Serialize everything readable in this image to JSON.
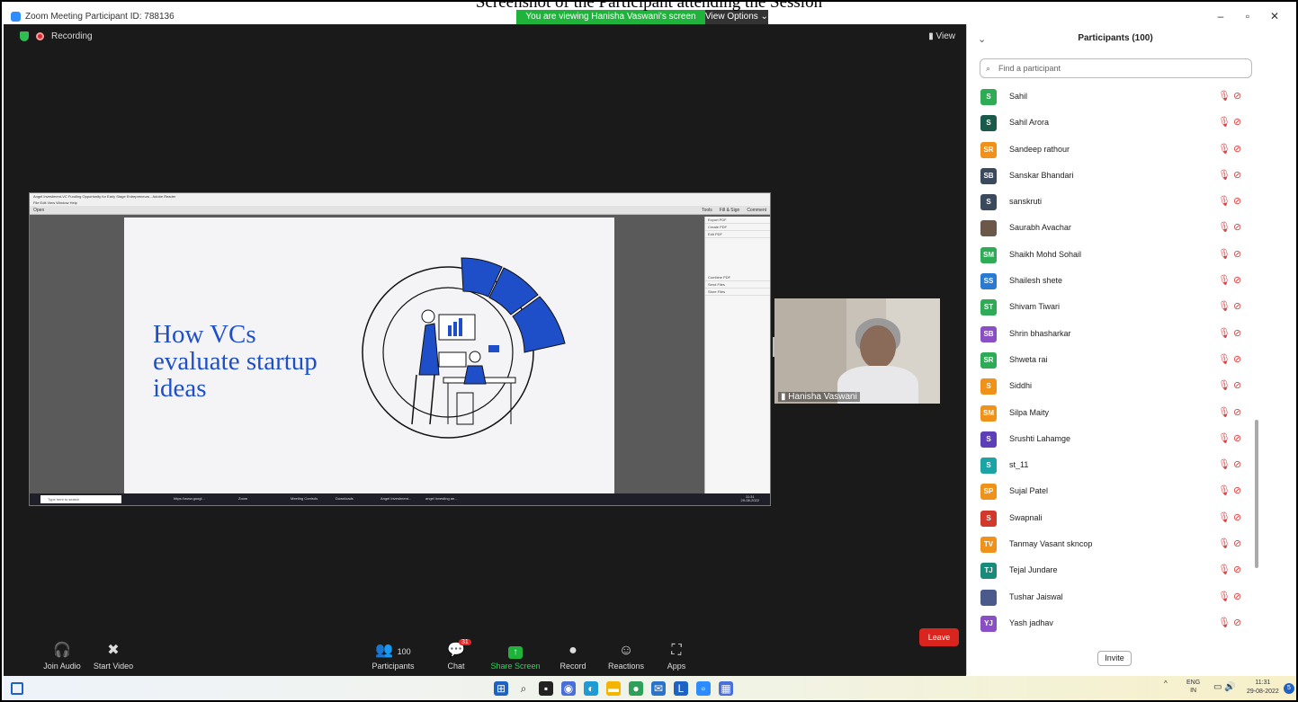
{
  "caption": "Screenshot of the Participant attending the Session",
  "window": {
    "title": "Zoom Meeting Participant ID: 788136",
    "viewing_banner": "You are viewing Hanisha Vaswani's screen",
    "view_options": "View Options ⌄"
  },
  "meeting": {
    "recording_label": "Recording",
    "view_label": "View"
  },
  "shared_screen": {
    "reader_title": "Angel Investment-VC Funding Opportunity for Early Stage Entrepreneurs - Adobe Reader",
    "reader_menu": "File  Edit  View  Window  Help",
    "open_label": "Open",
    "tabs": [
      "Tools",
      "Fill & Sign",
      "Comment"
    ],
    "slide_title": "How VCs evaluate startup ideas",
    "side_panel": [
      "Export PDF",
      "Create PDF",
      "Edit PDF",
      "Combine PDF",
      "Send Files",
      "Store Files"
    ],
    "taskbar_search": "Type here to search",
    "taskbar_apps": [
      "https://www.googl...",
      "Zoom",
      "Meeting Controls",
      "Downloads",
      "Angel Investment...",
      "angel investing an..."
    ],
    "taskbar_time": "11:31",
    "taskbar_date": "29-08-2022"
  },
  "video": {
    "name": "Hanisha Vaswani"
  },
  "toolbar": {
    "join_audio": "Join Audio",
    "start_video": "Start Video",
    "participants": "Participants",
    "participants_count": "100",
    "chat": "Chat",
    "chat_badge": "31",
    "share_screen": "Share Screen",
    "record": "Record",
    "reactions": "Reactions",
    "apps": "Apps",
    "leave": "Leave"
  },
  "panel": {
    "title": "Participants (100)",
    "search_placeholder": "Find a participant",
    "invite": "Invite",
    "participants": [
      {
        "initials": "S",
        "name": "Sahil",
        "color": "#2eab55"
      },
      {
        "initials": "S",
        "name": "Sahil Arora",
        "color": "#1a5a4a"
      },
      {
        "initials": "SR",
        "name": "Sandeep rathour",
        "color": "#f0921a"
      },
      {
        "initials": "SB",
        "name": "Sanskar Bhandari",
        "color": "#3a4a5c"
      },
      {
        "initials": "S",
        "name": "sanskruti",
        "color": "#3a4a5c"
      },
      {
        "initials": "",
        "name": "Saurabh Avachar",
        "color": "#6b5848"
      },
      {
        "initials": "SM",
        "name": "Shaikh Mohd Sohail",
        "color": "#2eab55"
      },
      {
        "initials": "SS",
        "name": "Shailesh shete",
        "color": "#2a7ad1"
      },
      {
        "initials": "ST",
        "name": "Shivam Tiwari",
        "color": "#2eab55"
      },
      {
        "initials": "SB",
        "name": "Shrin bhasharkar",
        "color": "#8a4fc4"
      },
      {
        "initials": "SR",
        "name": "Shweta rai",
        "color": "#2eab55"
      },
      {
        "initials": "S",
        "name": "Siddhi",
        "color": "#f0921a"
      },
      {
        "initials": "SM",
        "name": "Silpa Maity",
        "color": "#f0921a"
      },
      {
        "initials": "S",
        "name": "Srushti Lahamge",
        "color": "#5d3fb8"
      },
      {
        "initials": "S",
        "name": "st_11",
        "color": "#1ca3a3"
      },
      {
        "initials": "SP",
        "name": "Sujal Patel",
        "color": "#f0921a"
      },
      {
        "initials": "S",
        "name": "Swapnali",
        "color": "#d13a2a"
      },
      {
        "initials": "TV",
        "name": "Tanmay Vasant skncop",
        "color": "#f0921a"
      },
      {
        "initials": "TJ",
        "name": "Tejal Jundare",
        "color": "#1a8a7a"
      },
      {
        "initials": "",
        "name": "Tushar Jaiswal",
        "color": "#4a5a8a"
      },
      {
        "initials": "YJ",
        "name": "Yash jadhav",
        "color": "#8a4fc4"
      }
    ]
  },
  "taskbar": {
    "lang_top": "ENG",
    "lang_bottom": "IN",
    "time": "11:31",
    "date": "29-08-2022",
    "notifications": "5"
  }
}
